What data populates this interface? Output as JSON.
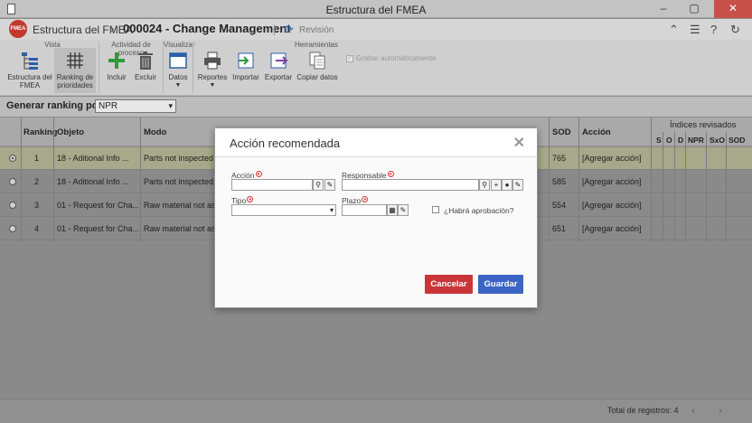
{
  "window": {
    "title": "Estructura del FMEA"
  },
  "header": {
    "logo_text": "FMEA",
    "breadcrumb_parent": "Estructura del FMEA",
    "breadcrumb_current": "000024 - Change Management",
    "revision_label": "Revisión"
  },
  "ribbon": {
    "groups": {
      "vista": "Vista",
      "actividad": "Actividad de proceso",
      "visualizar": "Visualizar",
      "herramientas": "Herramientas"
    },
    "buttons": {
      "estructura": "Estructura del FMEA",
      "ranking": "Ranking de prioridades",
      "incluir": "Incluir",
      "excluir": "Excluir",
      "datos": "Datos",
      "reportes": "Reportes",
      "importar": "Importar",
      "exportar": "Exportar",
      "copiar": "Copiar datos"
    },
    "autosave_label": "Grabar automáticamente"
  },
  "rankbar": {
    "label": "Generar ranking por:",
    "selected": "NPR"
  },
  "grid": {
    "headers": {
      "ranking": "Ranking",
      "objeto": "Objeto",
      "modo": "Modo",
      "sod": "SOD",
      "accion": "Acción",
      "indices": "Índices revisados",
      "s": "S",
      "o": "O",
      "d": "D",
      "npr": "NPR",
      "sxo": "SxO",
      "sod2": "SOD"
    },
    "rows": [
      {
        "ranking": "1",
        "objeto": "18 - Aditional Info ...",
        "modo": "Parts not inspected ...",
        "sod": "765",
        "accion": "[Agregar acción]"
      },
      {
        "ranking": "2",
        "objeto": "18 - Aditional Info ...",
        "modo": "Parts not inspected ...",
        "sod": "585",
        "accion": "[Agregar acción]"
      },
      {
        "ranking": "3",
        "objeto": "01 - Request for Cha...",
        "modo": "Raw material not as ...",
        "sod": "554",
        "accion": "[Agregar acción]"
      },
      {
        "ranking": "4",
        "objeto": "01 - Request for Cha...",
        "modo": "Raw material not as ...",
        "sod": "651",
        "accion": "[Agregar acción]"
      }
    ]
  },
  "footer": {
    "total": "Total de registros: 4"
  },
  "modal": {
    "title": "Acción recomendada",
    "fields": {
      "accion": {
        "label": "Acción",
        "value": ""
      },
      "responsable": {
        "label": "Responsable",
        "value": ""
      },
      "tipo": {
        "label": "Tipo",
        "value": ""
      },
      "plazo": {
        "label": "Plazo",
        "value": ""
      },
      "aprobacion": {
        "label": "¿Habrá aprobación?"
      }
    },
    "buttons": {
      "cancel": "Cancelar",
      "save": "Guardar"
    }
  },
  "colors": {
    "cancel": "#c9363a",
    "save": "#3b64c4",
    "accent": "#2c6fb5",
    "logo": "#c0392b"
  }
}
